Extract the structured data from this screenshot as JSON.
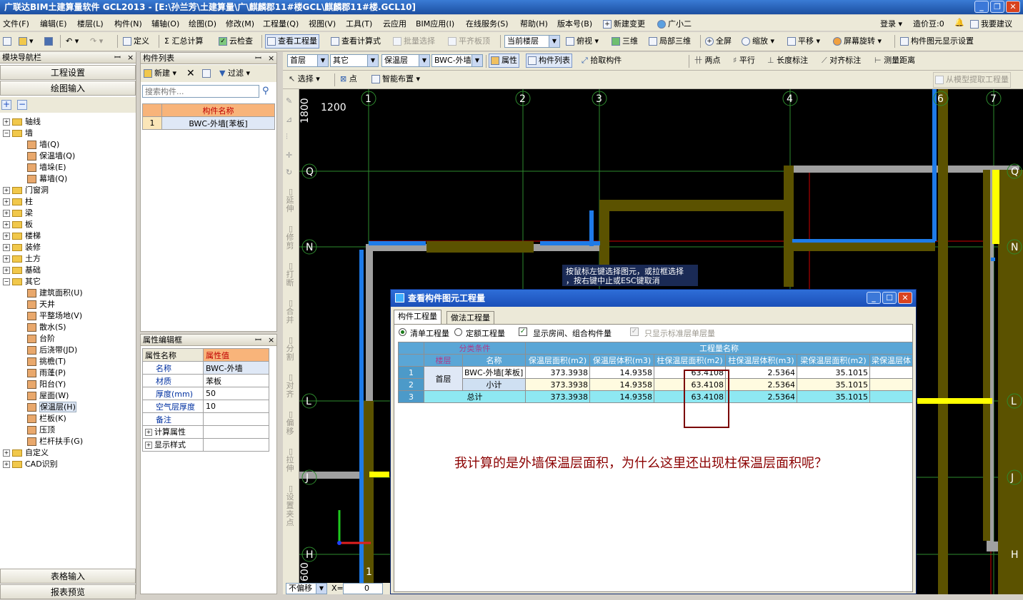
{
  "title": "广联达BIM土建算量软件 GCL2013 - [E:\\孙兰芳\\土建算量\\广\\麒麟郡11#楼GCL\\麒麟郡11#楼.GCL10]",
  "window_controls": {
    "minimize": "_",
    "restore": "❐",
    "close": "✕"
  },
  "menu": [
    "文件(F)",
    "编辑(E)",
    "楼层(L)",
    "构件(N)",
    "辅轴(O)",
    "绘图(D)",
    "修改(M)",
    "工程量(Q)",
    "视图(V)",
    "工具(T)",
    "云应用",
    "BIM应用(I)",
    "在线服务(S)",
    "帮助(H)",
    "版本号(B)"
  ],
  "menu_right": {
    "new_change": "新建变更",
    "assistant": "广小二",
    "login": "登录",
    "price_bean": "造价豆:0",
    "suggest": "我要建议"
  },
  "toolbar1": {
    "define": "定义",
    "sum_calc": "Σ 汇总计算",
    "cloud_check": "云检查",
    "view_qty": "查看工程量",
    "view_formula": "查看计算式",
    "batch_select": "批量选择",
    "align_top": "平齐板顶",
    "floor_combo": "当前楼层",
    "top_view": "俯视",
    "three_d": "三维",
    "local_3d": "局部三维",
    "fullscreen": "全屏",
    "zoom": "缩放",
    "pan": "平移",
    "rotate": "屏幕旋转",
    "display_settings": "构件图元显示设置"
  },
  "toolbar2": {
    "floor": "首层",
    "category": "其它",
    "type": "保温层",
    "component": "BWC-外墙",
    "property": "属性",
    "comp_list": "构件列表",
    "pick": "拾取构件",
    "two_points": "两点",
    "parallel": "平行",
    "length_mark": "长度标注",
    "align_mark": "对齐标注",
    "measure": "测量距离"
  },
  "toolbar3": {
    "select": "选择",
    "point": "点",
    "smart_layout": "智能布置",
    "extract": "从模型提取工程量"
  },
  "left_panel": {
    "header": "模块导航栏",
    "btn_settings": "工程设置",
    "btn_draw": "绘图输入",
    "tree": [
      {
        "label": "轴线",
        "level": 0,
        "expanded": false
      },
      {
        "label": "墙",
        "level": 0,
        "expanded": true
      },
      {
        "label": "墙(Q)",
        "level": 1
      },
      {
        "label": "保温墙(Q)",
        "level": 1
      },
      {
        "label": "墙垛(E)",
        "level": 1
      },
      {
        "label": "幕墙(Q)",
        "level": 1
      },
      {
        "label": "门窗洞",
        "level": 0,
        "expanded": false
      },
      {
        "label": "柱",
        "level": 0,
        "expanded": false
      },
      {
        "label": "梁",
        "level": 0,
        "expanded": false
      },
      {
        "label": "板",
        "level": 0,
        "expanded": false
      },
      {
        "label": "楼梯",
        "level": 0,
        "expanded": false
      },
      {
        "label": "装修",
        "level": 0,
        "expanded": false
      },
      {
        "label": "土方",
        "level": 0,
        "expanded": false
      },
      {
        "label": "基础",
        "level": 0,
        "expanded": false
      },
      {
        "label": "其它",
        "level": 0,
        "expanded": true
      },
      {
        "label": "建筑面积(U)",
        "level": 1
      },
      {
        "label": "天井",
        "level": 1
      },
      {
        "label": "平整场地(V)",
        "level": 1
      },
      {
        "label": "散水(S)",
        "level": 1
      },
      {
        "label": "台阶",
        "level": 1
      },
      {
        "label": "后浇带(JD)",
        "level": 1
      },
      {
        "label": "挑檐(T)",
        "level": 1
      },
      {
        "label": "雨蓬(P)",
        "level": 1
      },
      {
        "label": "阳台(Y)",
        "level": 1
      },
      {
        "label": "屋面(W)",
        "level": 1
      },
      {
        "label": "保温层(H)",
        "level": 1,
        "selected": true
      },
      {
        "label": "栏板(K)",
        "level": 1
      },
      {
        "label": "压顶",
        "level": 1
      },
      {
        "label": "栏杆扶手(G)",
        "level": 1
      },
      {
        "label": "自定义",
        "level": 0,
        "expanded": false
      },
      {
        "label": "CAD识别",
        "level": 0,
        "expanded": false
      }
    ],
    "btn_table": "表格输入",
    "btn_report": "报表预览"
  },
  "comp_list": {
    "header": "构件列表",
    "new": "新建",
    "filter": "过滤",
    "search_placeholder": "搜索构件...",
    "col_name": "构件名称",
    "rows": [
      {
        "no": "1",
        "name": "BWC-外墙[苯板]"
      }
    ]
  },
  "prop_panel": {
    "header": "属性编辑框",
    "col_name": "属性名称",
    "col_value": "属性值",
    "rows": [
      {
        "name": "名称",
        "value": "BWC-外墙"
      },
      {
        "name": "材质",
        "value": "苯板"
      },
      {
        "name": "厚度(mm)",
        "value": "50"
      },
      {
        "name": "空气层厚度",
        "value": "10"
      },
      {
        "name": "备注",
        "value": ""
      },
      {
        "name": "计算属性",
        "value": "",
        "group": true
      },
      {
        "name": "显示样式",
        "value": "",
        "group": true
      }
    ]
  },
  "vtoolbar": [
    "延伸",
    "修剪",
    "打断",
    "合并",
    "分割",
    "对齐",
    "偏移",
    "拉伸",
    "设置夹点"
  ],
  "canvas": {
    "dim_top_left": "1200",
    "dim_vertical": "1800",
    "dim_bottom": "600",
    "axes_x": [
      "1",
      "2",
      "3",
      "4",
      "6",
      "7"
    ],
    "axes_y": [
      "Q",
      "N",
      "L",
      "J",
      "H"
    ],
    "hint_line1": "按鼠标左键选择图元，或拉框选择",
    "hint_line2": "，按右键中止或ESC键取消",
    "bottom_axis": "1"
  },
  "dialog": {
    "title": "查看构件图元工程量",
    "tab1": "构件工程量",
    "tab2": "做法工程量",
    "radio_list": "清单工程量",
    "radio_quota": "定额工程量",
    "check_room": "显示房间、组合构件量",
    "check_std": "只显示标准层单层量",
    "header_category": "分类条件",
    "header_qty": "工程量名称",
    "col_floor": "楼层",
    "col_name": "名称",
    "columns": [
      "保温层面积(m2)",
      "保温层体积(m3)",
      "柱保温层面积(m2)",
      "柱保温层体积(m3)",
      "梁保温层面积(m2)",
      "梁保温层体"
    ],
    "rows": [
      {
        "no": "1",
        "floor": "首层",
        "name": "BWC-外墙[苯板]",
        "values": [
          "373.3938",
          "14.9358",
          "63.4108",
          "2.5364",
          "35.1015",
          ""
        ]
      },
      {
        "no": "2",
        "floor": "",
        "name": "小计",
        "values": [
          "373.3938",
          "14.9358",
          "63.4108",
          "2.5364",
          "35.1015",
          ""
        ]
      },
      {
        "no": "3",
        "floor": "",
        "name": "总计",
        "values": [
          "373.3938",
          "14.9358",
          "63.4108",
          "2.5364",
          "35.1015",
          ""
        ]
      }
    ],
    "annotation": "我计算的是外墙保温层面积，为什么这里还出现柱保温层面积呢？"
  },
  "statusbar": {
    "offset": "不偏移",
    "x_label": "X=",
    "x_value": "0"
  },
  "colors": {
    "title_blue": "#1c4fa0",
    "canvas": "#000000",
    "axis_green": "#2e8b2e",
    "wall_gray": "#a0a0a0",
    "insulation_olive": "#5b5200",
    "blue_wall": "#1e7be8",
    "yellow": "#ffff00",
    "red_line": "#d00000",
    "annot_red": "#8b0000"
  }
}
